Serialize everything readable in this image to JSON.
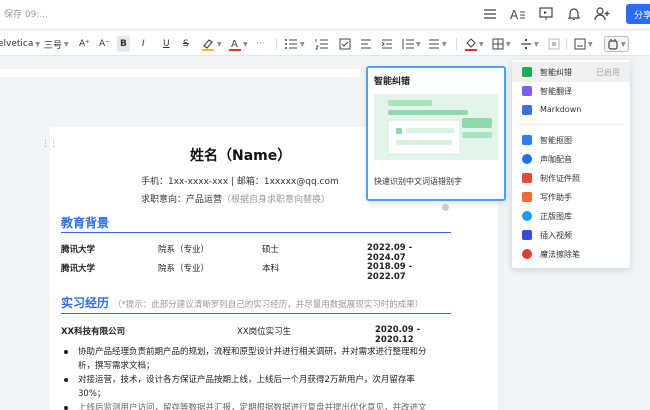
{
  "topbar": {
    "save_status": "保存 09:...",
    "share_label": "分享",
    "icons": [
      "menu-icon",
      "text-style-icon",
      "present-icon",
      "notification-icon",
      "add-user-icon"
    ]
  },
  "toolbar": {
    "font_name": "elvetica",
    "font_size": "三号",
    "grow_font": "A⁺",
    "shrink_font": "A⁻",
    "bold": "B",
    "italic": "I",
    "underline": "U",
    "strike": "S",
    "more": "···",
    "highlight_color": "#f5c518",
    "text_color": "#e03131"
  },
  "document": {
    "name": "姓名（Name）",
    "contact": "手机：1xx-xxxx-xxx | 邮箱：1xxxxx@qq.com",
    "intent_label": "求职意向：产品运营",
    "intent_hint": "（根据自身求职意向替换）",
    "education": {
      "title": "教育背景",
      "rows": [
        {
          "school": "腾讯大学",
          "dept": "院系（专业）",
          "degree": "硕士",
          "period": "2022.09 - 2024.07"
        },
        {
          "school": "腾讯大学",
          "dept": "院系（专业）",
          "degree": "本科",
          "period": "2018.09 - 2022.07"
        }
      ]
    },
    "internship": {
      "title": "实习经历",
      "hint": "（*提示：此部分建议清晰罗列自己的实习经历，并尽量用数据展现实习时的成果）",
      "company": "XX科技有限公司",
      "position": "XX岗位实习生",
      "period": "2020.09 - 2020.12",
      "bullets": [
        "协助产品经理负责前期产品的规划，流程和原型设计并进行相关调研，并对需求进行整理和分",
        "析，撰写需求文档；",
        "对接运营，技术，设计各方保证产品按期上线，上线后一个月获得2万新用户，次月留存率",
        "30%；",
        "上线后监测用户访问，留存等数据并汇报，定期根据数据进行复盘并提出优化意见，并改进文"
      ]
    }
  },
  "preview": {
    "title": "智能纠错",
    "description": "快速识别中文词语错别字"
  },
  "menu": {
    "items": [
      {
        "label": "智能纠错",
        "badge": "已启用",
        "color": "#1aad5a",
        "icon": "smart-correct-icon"
      },
      {
        "label": "智能翻译",
        "badge": "",
        "color": "#7b5cf5",
        "icon": "translate-icon"
      },
      {
        "label": "Markdown",
        "badge": "",
        "color": "#3b6fe0",
        "icon": "markdown-icon"
      },
      {
        "label": "智能抠图",
        "badge": "",
        "color": "#2d7ff9",
        "icon": "cutout-icon"
      },
      {
        "label": "声咖配音",
        "badge": "",
        "color": "#1e6fff",
        "icon": "dubbing-icon"
      },
      {
        "label": "制作证件照",
        "badge": "",
        "color": "#e8453c",
        "icon": "id-photo-icon"
      },
      {
        "label": "写作助手",
        "badge": "",
        "color": "#ef6a2e",
        "icon": "writing-assistant-icon"
      },
      {
        "label": "正版图库",
        "badge": "",
        "color": "#1e9be8",
        "icon": "image-library-icon"
      },
      {
        "label": "插入视频",
        "badge": "",
        "color": "#3a4dd8",
        "icon": "video-icon"
      },
      {
        "label": "魔法擦除笔",
        "badge": "",
        "color": "#e53935",
        "icon": "magic-eraser-icon"
      }
    ]
  }
}
